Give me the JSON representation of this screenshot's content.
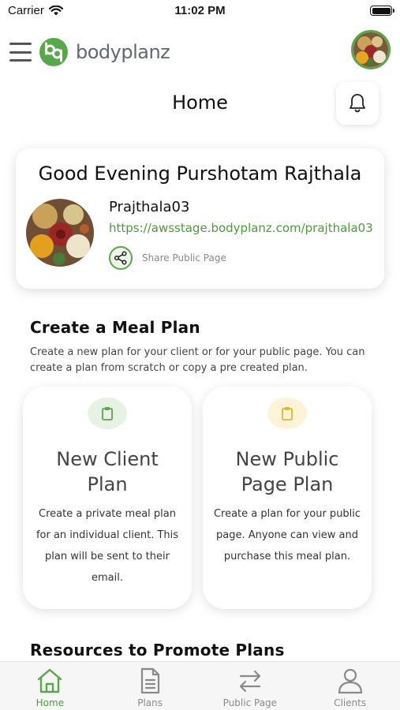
{
  "status_bar": {
    "carrier": "Carrier",
    "time": "11:02 PM"
  },
  "header": {
    "brand": "bodyplanz",
    "logo_initials": "bp",
    "page_title": "Home"
  },
  "welcome": {
    "greeting": "Good Evening Purshotam Rajthala",
    "username": "Prajthala03",
    "public_url": "https://awsstage.bodyplanz.com/prajthala03",
    "share_label": "Share Public Page"
  },
  "meal_plan": {
    "title": "Create a Meal Plan",
    "description": "Create a new plan for your client or for your public page. You can create a plan from scratch or copy a pre created plan.",
    "cards": [
      {
        "title": "New Client\nPlan",
        "description": "Create a private meal plan for an individual client. This plan will be sent to their email.",
        "icon": "clipboard-icon",
        "accent": "#5aa64a"
      },
      {
        "title": "New Public\nPage Plan",
        "description": "Create a plan for your public page. Anyone can view and purchase this meal plan.",
        "icon": "clipboard-icon",
        "accent": "#e6b820"
      }
    ]
  },
  "resources": {
    "title": "Resources to Promote Plans"
  },
  "tabbar": {
    "tabs": [
      {
        "label": "Home",
        "icon": "home-icon",
        "active": true
      },
      {
        "label": "Plans",
        "icon": "document-icon",
        "active": false
      },
      {
        "label": "Public Page",
        "icon": "swap-arrows-icon",
        "active": false
      },
      {
        "label": "Clients",
        "icon": "person-icon",
        "active": false
      }
    ]
  },
  "colors": {
    "brand_green": "#5aa64a",
    "link_green": "#4d9a3c",
    "accent_yellow": "#e6b820",
    "tab_inactive": "#8a8a8a"
  }
}
